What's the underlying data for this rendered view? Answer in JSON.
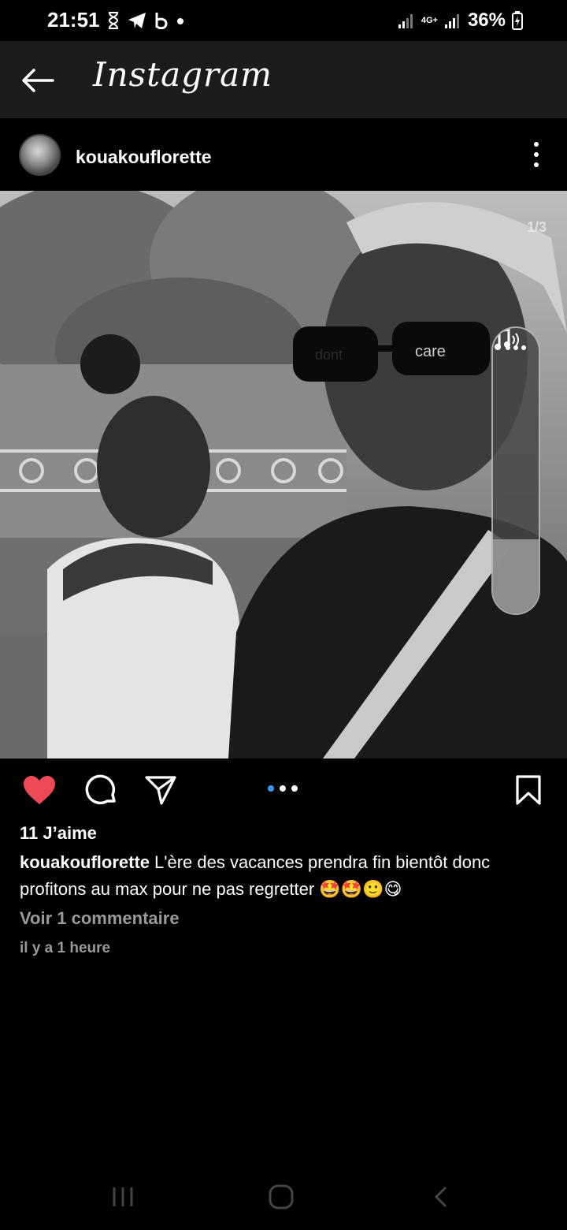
{
  "status_bar": {
    "time": "21:51",
    "network": "4G+",
    "battery": "36%"
  },
  "header": {
    "title": "Instagram"
  },
  "post": {
    "username": "kouakouflorette",
    "page_indicator": "1/3",
    "likes": "11 J’aime",
    "caption_user": "kouakouflorette",
    "caption_text": "L'ère des vacances prendra fin bientôt donc profitons au max pour ne pas regretter 🤩🤩🙂😋",
    "comments_link": "Voir 1 commentaire",
    "timestamp": "il y a 1 heure",
    "carousel_active_index": 0,
    "carousel_count": 3,
    "volume_level": 0.26,
    "liked": true
  },
  "colors": {
    "background": "#000000",
    "header_bg": "#1c1c1c",
    "like_red": "#ed4956",
    "carousel_active": "#3897f0",
    "muted_text": "#9a9a9a"
  }
}
